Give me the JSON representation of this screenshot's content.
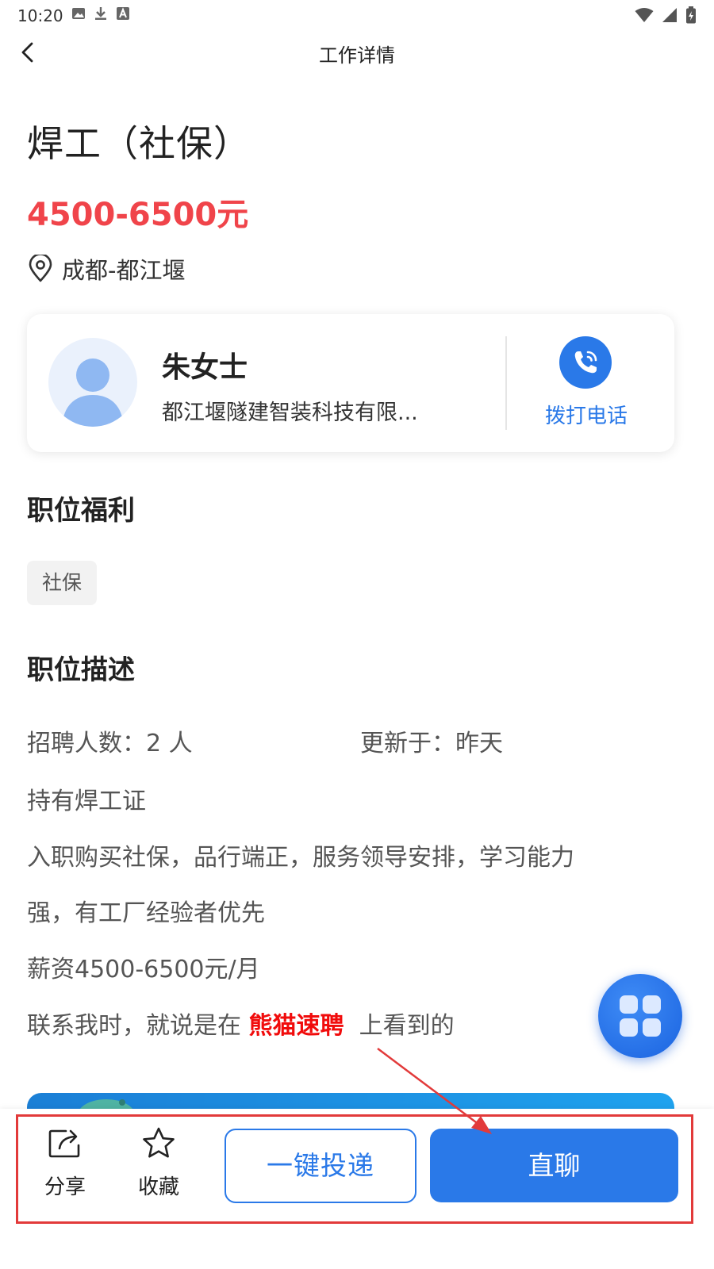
{
  "status_bar": {
    "time": "10:20"
  },
  "nav": {
    "title": "工作详情"
  },
  "job": {
    "title": "焊工（社保）",
    "salary": "4500-6500元",
    "location": "成都-都江堰"
  },
  "recruiter": {
    "name": "朱女士",
    "company": "都江堰隧建智装科技有限...",
    "call_label": "拨打电话"
  },
  "benefits": {
    "heading": "职位福利",
    "tags": [
      "社保"
    ]
  },
  "description": {
    "heading": "职位描述",
    "headcount": "招聘人数：2 人",
    "updated": "更新于：昨天",
    "lines": [
      "持有焊工证",
      "入职购买社保，品行端正，服务领导安排，学习能力",
      "强，有工厂经验者优先",
      "薪资4500-6500元/月"
    ],
    "contact_prefix": "联系我时，就说是在",
    "contact_brand": "熊猫速聘",
    "contact_suffix": "上看到的"
  },
  "bottom_bar": {
    "share_label": "分享",
    "favorite_label": "收藏",
    "apply_label": "一键投递",
    "chat_label": "直聊"
  },
  "colors": {
    "accent": "#2a79e8",
    "salary": "#f0444a",
    "brand_highlight": "#f10c0c",
    "annotation": "#e23a3a"
  },
  "icons": {
    "back": "chevron-left-icon",
    "location": "location-pin-icon",
    "call": "phone-icon",
    "share": "share-icon",
    "favorite": "star-icon",
    "float": "apps-grid-icon"
  }
}
